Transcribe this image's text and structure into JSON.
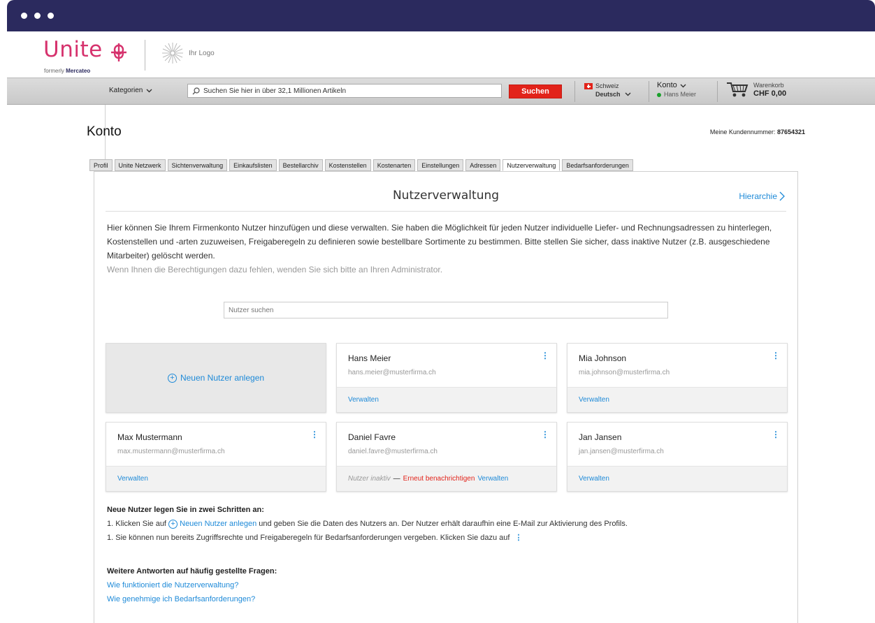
{
  "brand": {
    "name": "Unite",
    "sub_prefix": "formerly",
    "sub_name": "Mercateo",
    "your_logo": "Ihr Logo"
  },
  "nav": {
    "categories": "Kategorien",
    "search_placeholder": "Suchen Sie hier in über 32,1 Millionen Artikeln",
    "search_button": "Suchen",
    "country": "Schweiz",
    "language": "Deutsch",
    "account": "Konto",
    "account_user": "Hans Meier",
    "cart_label": "Warenkorb",
    "cart_total": "CHF 0,00"
  },
  "page": {
    "title": "Konto",
    "customer_label": "Meine Kundennummer:",
    "customer_number": "87654321"
  },
  "tabs": [
    "Profil",
    "Unite Netzwerk",
    "Sichtenverwaltung",
    "Einkaufslisten",
    "Bestellarchiv",
    "Kostenstellen",
    "Kostenarten",
    "Einstellungen",
    "Adressen",
    "Nutzerverwaltung",
    "Bedarfsanforderungen"
  ],
  "active_tab": "Nutzerverwaltung",
  "panel": {
    "title": "Nutzerverwaltung",
    "hierarchy_link": "Hierarchie",
    "intro": "Hier können Sie Ihrem Firmenkonto Nutzer hinzufügen und diese verwalten. Sie haben die Möglichkeit für jeden Nutzer individuelle Liefer- und Rechnungsadressen zu hinterlegen, Kostenstellen und -arten zuzuweisen, Freigaberegeln zu definieren sowie bestellbare Sortimente zu bestimmen. Bitte stellen Sie sicher, dass inaktive Nutzer (z.B. ausgeschiedene Mitarbeiter) gelöscht werden.",
    "intro_note": "Wenn Ihnen die Berechtigungen dazu fehlen, wenden Sie sich bitte an Ihren Administrator.",
    "user_search_placeholder": "Nutzer suchen",
    "new_user": "Neuen Nutzer anlegen",
    "manage": "Verwalten",
    "inactive_label": "Nutzer inaktiv",
    "inactive_dash": "—",
    "renotify": "Erneut benachrichtigen"
  },
  "users": [
    {
      "name": "Hans Meier",
      "email": "hans.meier@musterfirma.ch"
    },
    {
      "name": "Mia Johnson",
      "email": "mia.johnson@musterfirma.ch"
    },
    {
      "name": "Max Mustermann",
      "email": "max.mustermann@musterfirma.ch"
    },
    {
      "name": "Daniel Favre",
      "email": "daniel.favre@musterfirma.ch"
    },
    {
      "name": "Jan Jansen",
      "email": "jan.jansen@musterfirma.ch"
    }
  ],
  "steps": {
    "heading": "Neue Nutzer legen Sie in zwei Schritten an:",
    "step1_pre": "1. Klicken Sie auf",
    "step1_link": "Neuen Nutzer anlegen",
    "step1_post": "und geben Sie die Daten des Nutzers an. Der Nutzer erhält daraufhin eine E-Mail zur Aktivierung des Profils.",
    "step2": "1. Sie können nun bereits Zugriffsrechte und Freigaberegeln für Bedarfsanforderungen vergeben. Klicken Sie dazu auf"
  },
  "faq": {
    "heading": "Weitere Antworten auf häufig gestellte Fragen:",
    "q1": "Wie funktioniert die Nutzerverwaltung?",
    "q2": "Wie genehmige ich Bedarfsanforderungen?"
  }
}
